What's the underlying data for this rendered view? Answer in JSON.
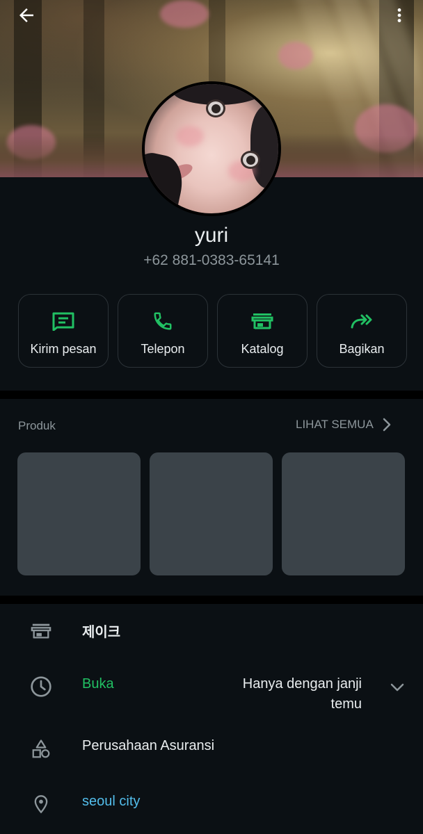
{
  "header": {
    "back_icon": "arrow-left-icon",
    "menu_icon": "more-vert-icon"
  },
  "profile": {
    "name": "yuri",
    "phone": "+62 881-0383-65141"
  },
  "actions": [
    {
      "label": "Kirim pesan",
      "icon": "message-icon"
    },
    {
      "label": "Telepon",
      "icon": "phone-icon"
    },
    {
      "label": "Katalog",
      "icon": "storefront-icon"
    },
    {
      "label": "Bagikan",
      "icon": "share-forward-icon"
    }
  ],
  "products": {
    "title": "Produk",
    "see_all": "LIHAT SEMUA",
    "count_placeholders": 3
  },
  "info": {
    "business_name": "제이크",
    "status": "Buka",
    "hours": "Hanya dengan janji temu",
    "category": "Perusahaan Asuransi",
    "location": "seoul city"
  },
  "colors": {
    "background": "#0b1014",
    "accent_green": "#21c063",
    "link_blue": "#53bdeb",
    "muted_text": "#8d969b",
    "placeholder": "#3b4349"
  }
}
